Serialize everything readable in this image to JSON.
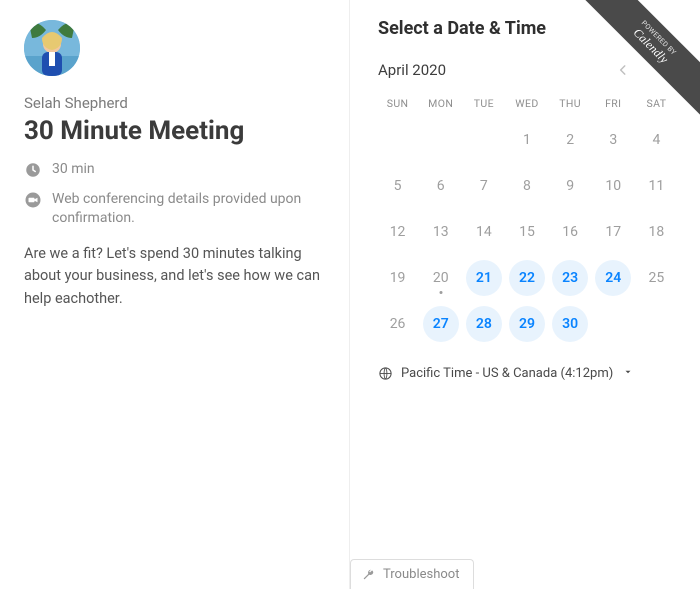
{
  "host": {
    "name": "Selah Shepherd"
  },
  "event": {
    "title": "30 Minute Meeting",
    "duration": "30 min",
    "location": "Web conferencing details provided upon confirmation.",
    "description": "Are we a fit? Let's spend 30 minutes talking about your business, and let's see how we can help eachother."
  },
  "right": {
    "heading": "Select a Date & Time",
    "month_label": "April 2020",
    "dow": [
      "SUN",
      "MON",
      "TUE",
      "WED",
      "THU",
      "FRI",
      "SAT"
    ],
    "weeks": [
      [
        {
          "n": "",
          "a": false
        },
        {
          "n": "",
          "a": false
        },
        {
          "n": "",
          "a": false
        },
        {
          "n": "1",
          "a": false
        },
        {
          "n": "2",
          "a": false
        },
        {
          "n": "3",
          "a": false
        },
        {
          "n": "4",
          "a": false
        }
      ],
      [
        {
          "n": "5",
          "a": false
        },
        {
          "n": "6",
          "a": false
        },
        {
          "n": "7",
          "a": false
        },
        {
          "n": "8",
          "a": false
        },
        {
          "n": "9",
          "a": false
        },
        {
          "n": "10",
          "a": false
        },
        {
          "n": "11",
          "a": false
        }
      ],
      [
        {
          "n": "12",
          "a": false
        },
        {
          "n": "13",
          "a": false
        },
        {
          "n": "14",
          "a": false
        },
        {
          "n": "15",
          "a": false
        },
        {
          "n": "16",
          "a": false
        },
        {
          "n": "17",
          "a": false
        },
        {
          "n": "18",
          "a": false
        }
      ],
      [
        {
          "n": "19",
          "a": false
        },
        {
          "n": "20",
          "a": false,
          "dot": true
        },
        {
          "n": "21",
          "a": true
        },
        {
          "n": "22",
          "a": true
        },
        {
          "n": "23",
          "a": true
        },
        {
          "n": "24",
          "a": true
        },
        {
          "n": "25",
          "a": false
        }
      ],
      [
        {
          "n": "26",
          "a": false
        },
        {
          "n": "27",
          "a": true
        },
        {
          "n": "28",
          "a": true
        },
        {
          "n": "29",
          "a": true
        },
        {
          "n": "30",
          "a": true
        },
        {
          "n": "",
          "a": false
        },
        {
          "n": "",
          "a": false
        }
      ]
    ],
    "timezone": "Pacific Time - US & Canada (4:12pm)"
  },
  "branding": {
    "powered_by": "POWERED BY",
    "name": "Calendly"
  },
  "footer": {
    "troubleshoot": "Troubleshoot"
  }
}
